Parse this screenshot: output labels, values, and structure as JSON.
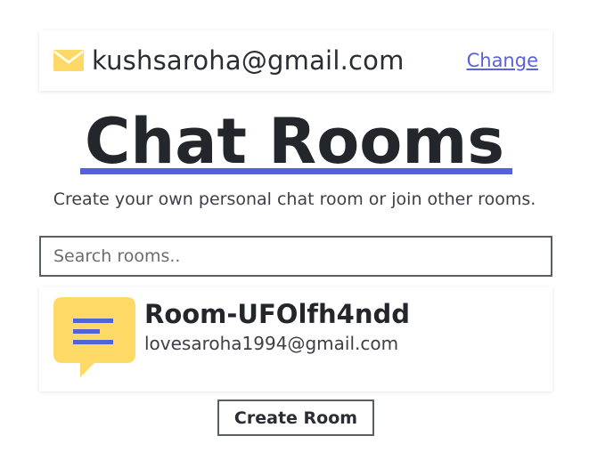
{
  "user": {
    "email": "kushsaroha@gmail.com",
    "change_label": "Change",
    "icon": "envelope-icon"
  },
  "header": {
    "title": "Chat Rooms",
    "subtitle": "Create your own personal chat room or join other rooms."
  },
  "search": {
    "placeholder": "Search rooms..",
    "value": ""
  },
  "rooms": [
    {
      "name": "Room-UFOlfh4ndd",
      "owner": "lovesaroha1994@gmail.com",
      "icon": "chat-bubble-icon"
    }
  ],
  "actions": {
    "create_label": "Create Room"
  },
  "colors": {
    "accent": "#5561d6",
    "icon_yellow": "#ffd966",
    "text": "#23262b",
    "border": "#5b6066"
  }
}
